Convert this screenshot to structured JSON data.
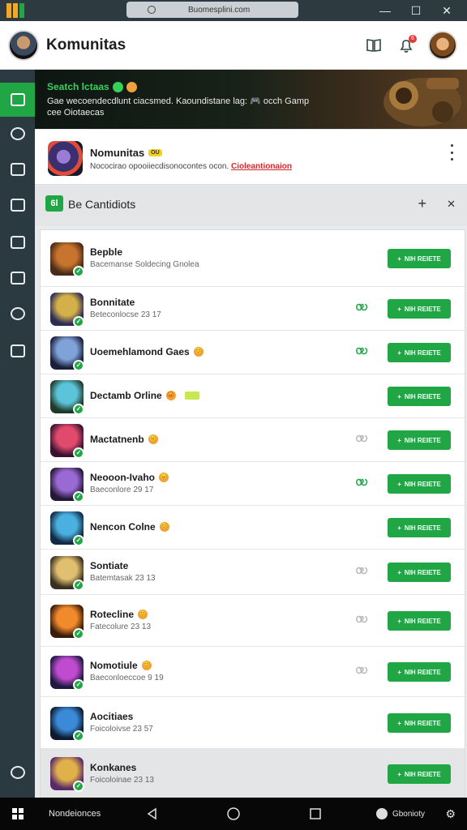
{
  "titlebar": {
    "url": "Buomesplini.com",
    "logo_colors": [
      "#f5a623",
      "#f5a623",
      "#21a646"
    ],
    "window_buttons": [
      "—",
      "☐",
      "✕"
    ]
  },
  "header": {
    "title": "Komunitas",
    "notification_count": "6"
  },
  "banner": {
    "title": "Seatch lctaas",
    "text": "Gae wecoendecdlunt ciacsmed. Kaoundistane lag: 🎮 occh Gamp cee Oiotaecas"
  },
  "community": {
    "name": "Nomunitas",
    "badge": "OU",
    "description": "Nococirao opooiiecdisonocontes ocon.",
    "link": "Cioleantionaion"
  },
  "section": {
    "icon": "6l",
    "title": "Be Cantidiots",
    "add_label": "+",
    "collapse_label": "✕"
  },
  "join_label": "NIH REIETE",
  "games": [
    {
      "name": "Bepble",
      "sub": "Bacemanse Soldecing Gnolea",
      "emoji": "",
      "tag": false,
      "pair": "",
      "art": [
        "#c8742e",
        "#4a2a18"
      ]
    },
    {
      "name": "Bonnitate",
      "sub": "Beteconlocse 23 17",
      "emoji": "",
      "tag": false,
      "pair": "green",
      "art": [
        "#d4b04a",
        "#2c2c55"
      ]
    },
    {
      "name": "Uoemehlamond Gaes",
      "sub": "",
      "emoji": "😊",
      "tag": false,
      "pair": "green",
      "art": [
        "#7fa2d8",
        "#1c1f3a"
      ]
    },
    {
      "name": "Dectamb Orline",
      "sub": "",
      "emoji": "😡",
      "tag": true,
      "pair": "",
      "art": [
        "#5cc4d8",
        "#203a2a"
      ]
    },
    {
      "name": "Mactatnenb",
      "sub": "",
      "emoji": "😐",
      "tag": false,
      "pair": "grey",
      "art": [
        "#e24a6c",
        "#3a1230"
      ]
    },
    {
      "name": "Neooon-Ivaho",
      "sub": "Baeconlore 29 17",
      "emoji": "😠",
      "tag": false,
      "pair": "green",
      "art": [
        "#9a6ad4",
        "#241838"
      ]
    },
    {
      "name": "Nencon Colne",
      "sub": "",
      "emoji": "😊",
      "tag": false,
      "pair": "",
      "art": [
        "#4ab0e0",
        "#122a44"
      ]
    },
    {
      "name": "Sontiate",
      "sub": "Batemtasak 23 13",
      "emoji": "",
      "tag": false,
      "pair": "grey",
      "art": [
        "#e0c070",
        "#3a3020"
      ]
    },
    {
      "name": "Rotecline",
      "sub": "Fatecolure 23 13",
      "emoji": "😊",
      "tag": false,
      "pair": "grey",
      "art": [
        "#f08a2a",
        "#3a1a0a"
      ]
    },
    {
      "name": "Nomotiule",
      "sub": "Baeconloeccoe 9 19",
      "emoji": "😊",
      "tag": false,
      "pair": "grey",
      "art": [
        "#c04ad0",
        "#1c1a3e"
      ]
    },
    {
      "name": "Aocitiaes",
      "sub": "Foicoloivse 23 57",
      "emoji": "",
      "tag": false,
      "pair": "",
      "art": [
        "#3a8ad8",
        "#0e1a30"
      ]
    },
    {
      "name": "Konkanes",
      "sub": "Foicoloinae 23 13",
      "emoji": "",
      "tag": false,
      "pair": "",
      "art": [
        "#e0b04a",
        "#5a2a68"
      ]
    }
  ],
  "taskbar": {
    "label": "Nondeionces",
    "status": "Gbonioty"
  },
  "colors": {
    "accent": "#21a646",
    "sidebar": "#2b3a40",
    "danger": "#d7262b"
  }
}
